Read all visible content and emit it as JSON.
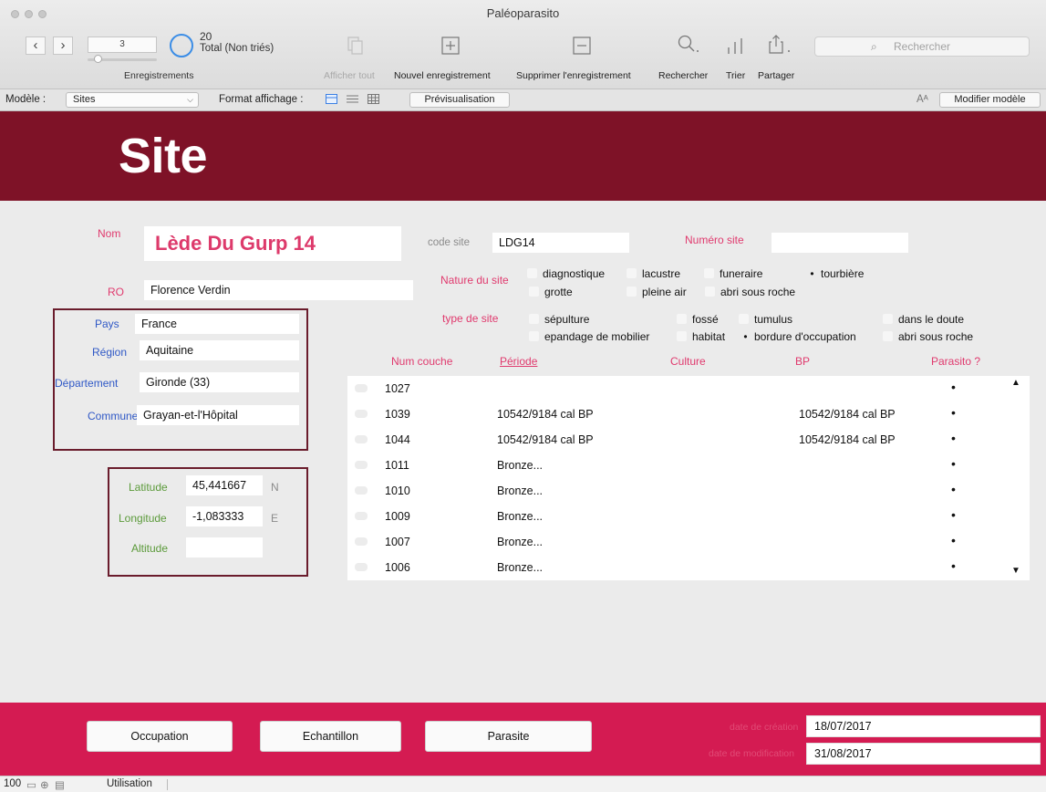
{
  "window": {
    "title": "Paléoparasito"
  },
  "toolbar": {
    "record_value": "3",
    "records_caption": "Enregistrements",
    "total_count": "20",
    "total_label": "Total (Non triés)",
    "show_all": "Afficher tout",
    "new_record": "Nouvel enregistrement",
    "delete_record": "Supprimer l'enregistrement",
    "find": "Rechercher",
    "sort": "Trier",
    "share": "Partager",
    "search_placeholder": "Rechercher"
  },
  "layoutbar": {
    "layout_label": "Modèle :",
    "layout_value": "Sites",
    "view_as_label": "Format affichage :",
    "preview": "Prévisualisation",
    "font_icon": "Aᴬ",
    "edit_layout": "Modifier modèle"
  },
  "header": {
    "title": "Site"
  },
  "form": {
    "nom_label": "Nom",
    "nom_value": "Lède Du Gurp 14",
    "code_label": "code site",
    "code_value": "LDG14",
    "numero_label": "Numéro site",
    "numero_value": "",
    "ro_label": "RO",
    "ro_value": "Florence Verdin",
    "pays_label": "Pays",
    "pays_value": "France",
    "region_label": "Région",
    "region_value": "Aquitaine",
    "departement_label": "Département",
    "departement_value": "Gironde (33)",
    "commune_label": "Commune",
    "commune_value": "Grayan-et-l'Hôpital",
    "latitude_label": "Latitude",
    "latitude_value": "45,441667",
    "latitude_unit": "N",
    "longitude_label": "Longitude",
    "longitude_value": "-1,083333",
    "longitude_unit": "E",
    "altitude_label": "Altitude",
    "altitude_value": ""
  },
  "nature": {
    "label": "Nature du site",
    "options": [
      "diagnostique",
      "lacustre",
      "funeraire",
      "tourbière",
      "grotte",
      "pleine air",
      "abri sous roche"
    ],
    "selected": "tourbière"
  },
  "type": {
    "label": "type de site",
    "options": [
      "sépulture",
      "fossé",
      "tumulus",
      "dans le doute",
      "epandage de mobilier",
      "habitat",
      "bordure d'occupation",
      "abri sous roche"
    ],
    "selected": "bordure d'occupation"
  },
  "table": {
    "headers": {
      "num_couche": "Num couche",
      "periode": "Période",
      "culture": "Culture",
      "bp": "BP",
      "parasito": "Parasito ?"
    },
    "parasito_mark": "•",
    "rows": [
      {
        "num": "1027",
        "periode": "",
        "culture": "",
        "bp": ""
      },
      {
        "num": "1039",
        "periode": "10542/9184 cal BP",
        "culture": "",
        "bp": "10542/9184 cal BP"
      },
      {
        "num": "1044",
        "periode": "10542/9184 cal BP",
        "culture": "",
        "bp": "10542/9184 cal BP"
      },
      {
        "num": "1011",
        "periode": "Bronze...",
        "culture": "",
        "bp": ""
      },
      {
        "num": "1010",
        "periode": "Bronze...",
        "culture": "",
        "bp": ""
      },
      {
        "num": "1009",
        "periode": "Bronze...",
        "culture": "",
        "bp": ""
      },
      {
        "num": "1007",
        "periode": "Bronze...",
        "culture": "",
        "bp": ""
      },
      {
        "num": "1006",
        "periode": "Bronze...",
        "culture": "",
        "bp": ""
      }
    ]
  },
  "footer": {
    "btn_occupation": "Occupation",
    "btn_echantillon": "Echantillon",
    "btn_parasite": "Parasite",
    "creation_label": "date de création",
    "creation_value": "18/07/2017",
    "modif_label": "date de modification",
    "modif_value": "31/08/2017"
  },
  "statusbar": {
    "zoom": "100",
    "mode": "Utilisation"
  },
  "colors": {
    "header": "#7e1227",
    "footer": "#d41b52",
    "label_pink": "#e03a6e",
    "label_blue": "#2f58c6",
    "label_green": "#5b9a3a",
    "frame": "#6a1c2c"
  }
}
